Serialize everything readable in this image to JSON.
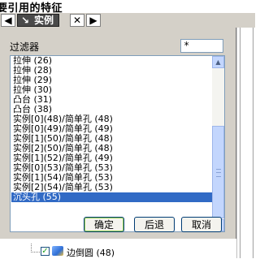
{
  "window": {
    "title": "要引用的特征"
  },
  "tabbar": {
    "prev_glyph": "◀",
    "next_glyph": "▶",
    "active_tab_arrow": "↘",
    "active_tab_label": "实例",
    "close_glyph": "✕"
  },
  "filter": {
    "label": "过滤器",
    "value": "*"
  },
  "list": {
    "items": [
      "拉伸 (26)",
      "拉伸 (28)",
      "拉伸 (29)",
      "拉伸 (30)",
      "凸台 (31)",
      "凸台 (38)",
      "实例[0](48)/简单孔 (48)",
      "实例[0](49)/简单孔 (49)",
      "实例[1](50)/简单孔 (48)",
      "实例[2](50)/简单孔 (48)",
      "实例[1](52)/简单孔 (49)",
      "实例[0](53)/简单孔 (53)",
      "实例[1](54)/简单孔 (53)",
      "实例[2](54)/简单孔 (53)",
      "沉头孔 (55)"
    ],
    "selected_index": 14,
    "scroll_up_glyph": "▲",
    "scroll_down_glyph": "▼"
  },
  "buttons": {
    "ok": "确定",
    "back": "后退",
    "cancel": "取消"
  },
  "tree": {
    "item_label": "边倒圆 (48)",
    "checkbox_mark": "✓"
  }
}
